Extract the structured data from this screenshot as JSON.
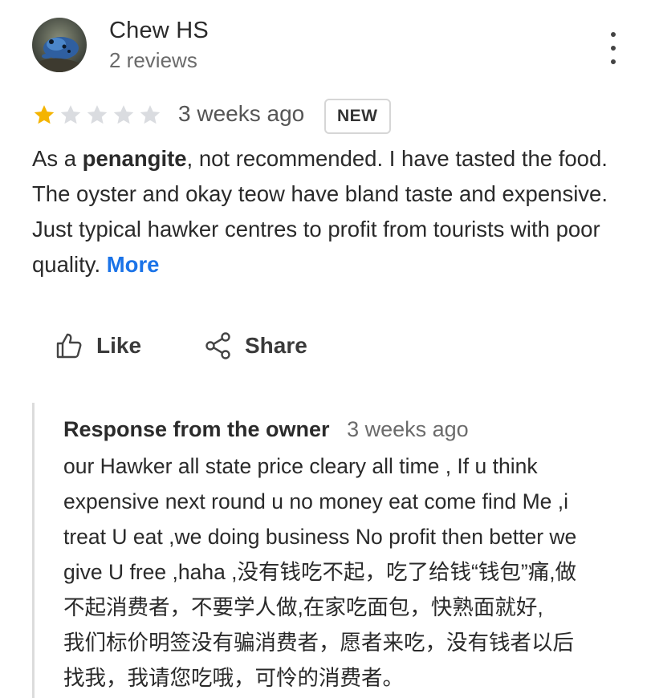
{
  "reviewer": {
    "name": "Chew HS",
    "meta": "2 reviews",
    "avatar_icon": "frog-photo-avatar"
  },
  "menu_icon": "more-vert-icon",
  "rating": {
    "stars": 1,
    "max_stars": 5,
    "filled_color": "#f4b400",
    "empty_color": "#dadce0",
    "time_ago": "3 weeks ago",
    "badge": "NEW"
  },
  "review": {
    "prefix": "As a ",
    "bold": "penangite",
    "body": ", not recommended.  I have tasted the food. The oyster and okay teow have bland taste and expensive. Just typical hawker centres to profit from tourists with poor quality.",
    "more": "More",
    "more_color": "#1a73e8"
  },
  "actions": {
    "like_label": "Like",
    "share_label": "Share",
    "like_icon": "thumbs-up-icon",
    "share_icon": "share-icon"
  },
  "owner_response": {
    "title": "Response from the owner",
    "time": "3 weeks ago",
    "text": "our Hawker all state price cleary all time , If u think\nexpensive next round u no money eat come find Me ,i\ntreat U eat ,we doing business No profit then better we\ngive U free ,haha ,没有钱吃不起，吃了给钱“钱包”痛,做\n不起消费者，不要学人做,在家吃面包，快熟面就好,\n我们标价明签没有骗消费者，愿者来吃，没有钱者以后\n找我，我请您吃哦，可怜的消费者。"
  }
}
